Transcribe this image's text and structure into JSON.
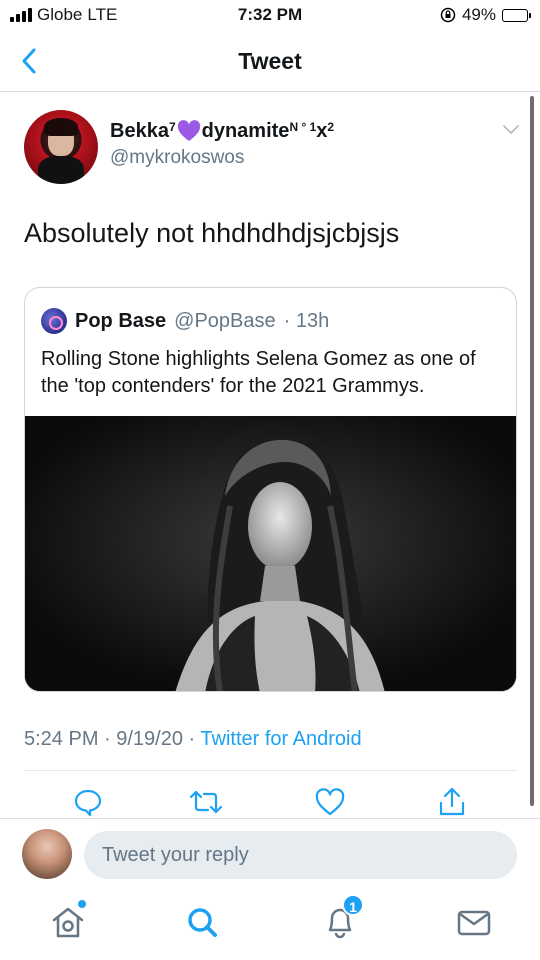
{
  "status_bar": {
    "carrier": "Globe",
    "network": "LTE",
    "time": "7:32 PM",
    "battery": "49%",
    "battery_level": 0.49
  },
  "nav": {
    "title": "Tweet",
    "back_icon": "chevron-left-icon"
  },
  "tweet": {
    "display_name_main": "Bekka",
    "display_name_sup1": "7",
    "display_name_after": "dynamite",
    "display_name_sup2": "N ° 1",
    "display_name_x": "x",
    "display_name_sup3": "2",
    "handle": "@mykrokoswos",
    "text": "Absolutely not hhdhdhdjsjcbjsjs",
    "timestamp": "5:24 PM · 9/19/20 ·",
    "source": "Twitter for Android"
  },
  "quote": {
    "name": "Pop Base",
    "handle": "@PopBase",
    "time": "· 13h",
    "text": "Rolling Stone highlights Selena Gomez as one of the 'top contenders' for the 2021 Grammys."
  },
  "reply": {
    "placeholder": "Tweet your reply"
  },
  "tabbar": {
    "notifications_badge": "1"
  },
  "colors": {
    "accent": "#1da1f2",
    "secondary_text": "#657786",
    "heart": "#9b59e6"
  }
}
